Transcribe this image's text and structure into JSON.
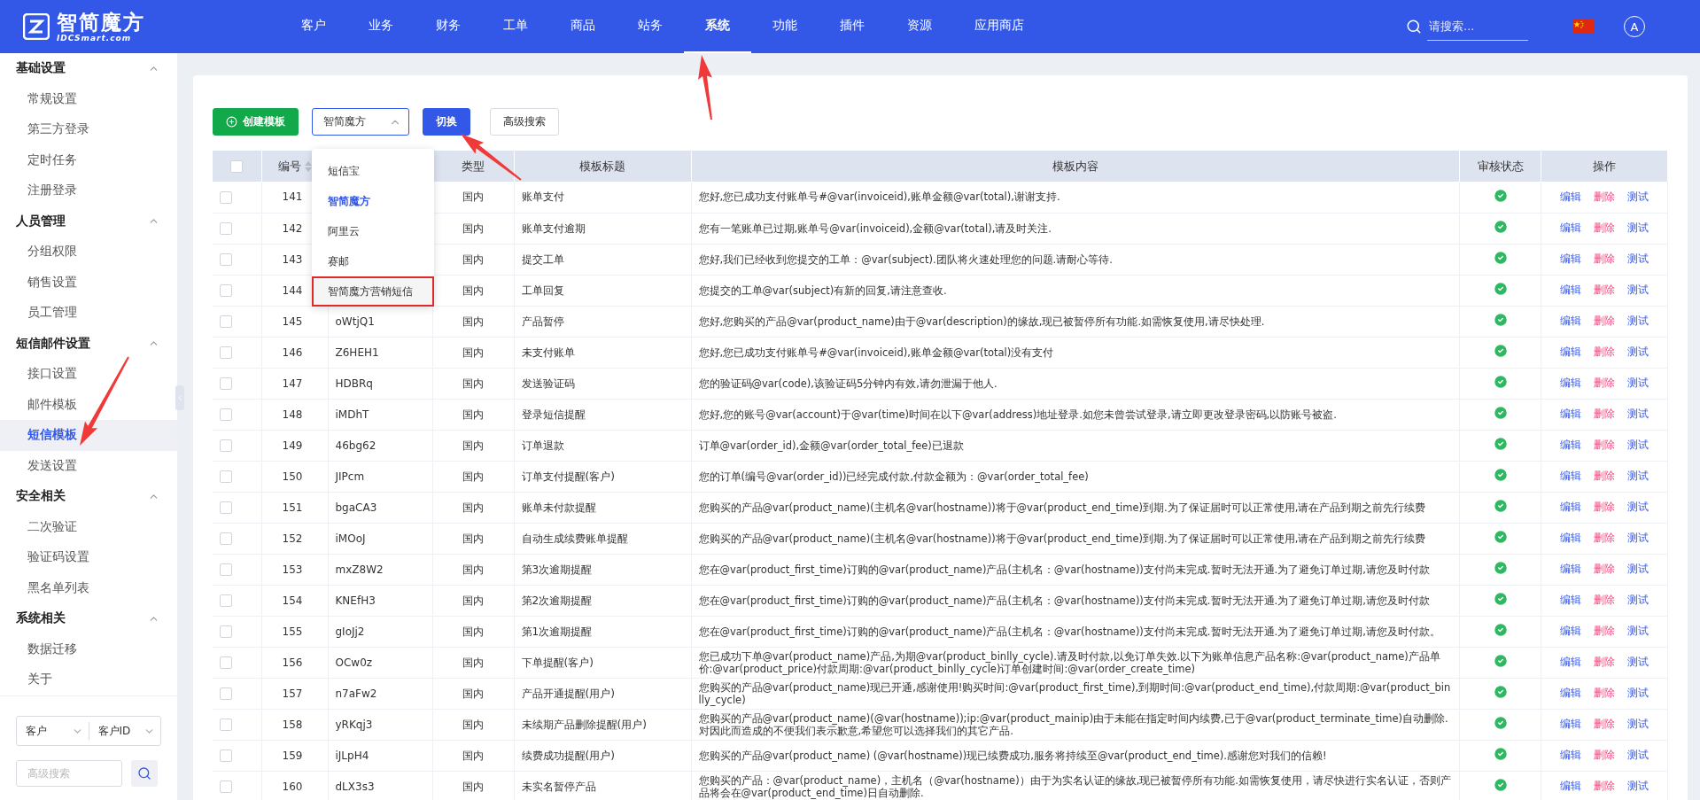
{
  "header": {
    "logo": {
      "name": "智简魔方",
      "domain": "IDCSmart.com"
    },
    "nav": [
      {
        "label": "客户",
        "selected": false
      },
      {
        "label": "业务",
        "selected": false
      },
      {
        "label": "财务",
        "selected": false
      },
      {
        "label": "工单",
        "selected": false
      },
      {
        "label": "商品",
        "selected": false
      },
      {
        "label": "站务",
        "selected": false
      },
      {
        "label": "系统",
        "selected": true
      },
      {
        "label": "功能",
        "selected": false
      },
      {
        "label": "插件",
        "selected": false
      },
      {
        "label": "资源",
        "selected": false
      },
      {
        "label": "应用商店",
        "selected": false
      }
    ],
    "search": {
      "placeholder": "请搜索..."
    },
    "avatar": "A"
  },
  "sidebar": {
    "groups": [
      {
        "title": "基础设置",
        "expanded": true,
        "items": [
          {
            "label": "常规设置",
            "selected": false
          },
          {
            "label": "第三方登录",
            "selected": false
          },
          {
            "label": "定时任务",
            "selected": false
          },
          {
            "label": "注册登录",
            "selected": false
          }
        ]
      },
      {
        "title": "人员管理",
        "expanded": true,
        "items": [
          {
            "label": "分组权限",
            "selected": false
          },
          {
            "label": "销售设置",
            "selected": false
          },
          {
            "label": "员工管理",
            "selected": false
          }
        ]
      },
      {
        "title": "短信邮件设置",
        "expanded": true,
        "items": [
          {
            "label": "接口设置",
            "selected": false
          },
          {
            "label": "邮件模板",
            "selected": false
          },
          {
            "label": "短信模板",
            "selected": true
          },
          {
            "label": "发送设置",
            "selected": false
          }
        ]
      },
      {
        "title": "安全相关",
        "expanded": true,
        "items": [
          {
            "label": "二次验证",
            "selected": false
          },
          {
            "label": "验证码设置",
            "selected": false
          },
          {
            "label": "黑名单列表",
            "selected": false
          }
        ]
      },
      {
        "title": "系统相关",
        "expanded": true,
        "items": [
          {
            "label": "数据迁移",
            "selected": false
          },
          {
            "label": "关于",
            "selected": false
          }
        ]
      }
    ],
    "filters": {
      "field_select": "客户",
      "id_select": "客户ID",
      "search": {
        "placeholder": "高级搜索"
      }
    }
  },
  "toolbar": {
    "create_button": "创建模板",
    "provider_select": {
      "value": "智简魔方",
      "expanded": true,
      "options": [
        {
          "label": "短信宝",
          "selected": false,
          "highlighted": false
        },
        {
          "label": "智简魔方",
          "selected": true,
          "highlighted": false
        },
        {
          "label": "阿里云",
          "selected": false,
          "highlighted": false
        },
        {
          "label": "赛邮",
          "selected": false,
          "highlighted": false
        },
        {
          "label": "智简魔方营销短信",
          "selected": false,
          "highlighted": true
        }
      ]
    },
    "switch_button": "切换",
    "advanced_search_button": "高级搜索"
  },
  "table": {
    "header_checked": false,
    "columns": [
      "编号",
      "类型",
      "模板标题",
      "模板内容",
      "审核状态",
      "操作"
    ],
    "rows": [
      {
        "id": "141",
        "type": "国内",
        "title": "账单支付",
        "content": "您好,您已成功支付账单号#@var(invoiceid),账单金额@var(total),谢谢支持.",
        "approved": true,
        "checked": false,
        "actions": [
          {
            "label": "编辑",
            "kind": "link"
          },
          {
            "label": "删除",
            "kind": "danger"
          },
          {
            "label": "测试",
            "kind": "link"
          }
        ]
      },
      {
        "id": "142",
        "type": "国内",
        "title": "账单支付逾期",
        "content": "您有一笔账单已过期,账单号@var(invoiceid),金额@var(total),请及时关注.",
        "approved": true,
        "checked": false,
        "actions": [
          {
            "label": "编辑",
            "kind": "link"
          },
          {
            "label": "删除",
            "kind": "danger"
          },
          {
            "label": "测试",
            "kind": "link"
          }
        ]
      },
      {
        "id": "143",
        "type": "国内",
        "title": "提交工单",
        "content": "您好,我们已经收到您提交的工单：@var(subject).团队将火速处理您的问题.请耐心等待.",
        "approved": true,
        "checked": false,
        "actions": [
          {
            "label": "编辑",
            "kind": "link"
          },
          {
            "label": "删除",
            "kind": "danger"
          },
          {
            "label": "测试",
            "kind": "link"
          }
        ]
      },
      {
        "id": "144",
        "type": "国内",
        "title": "工单回复",
        "content": "您提交的工单@var(subject)有新的回复,请注意查收.",
        "approved": true,
        "checked": false,
        "actions": [
          {
            "label": "编辑",
            "kind": "link"
          },
          {
            "label": "删除",
            "kind": "danger"
          },
          {
            "label": "测试",
            "kind": "link"
          }
        ]
      },
      {
        "id": "145",
        "code": "oWtjQ1",
        "type": "国内",
        "title": "产品暂停",
        "content": "您好,您购买的产品@var(product_name)由于@var(description)的缘故,现已被暂停所有功能.如需恢复使用,请尽快处理.",
        "approved": true,
        "checked": false,
        "actions": [
          {
            "label": "编辑",
            "kind": "link"
          },
          {
            "label": "删除",
            "kind": "danger"
          },
          {
            "label": "测试",
            "kind": "link"
          }
        ]
      },
      {
        "id": "146",
        "code": "Z6HEH1",
        "type": "国内",
        "title": "未支付账单",
        "content": "您好,您已成功支付账单号#@var(invoiceid),账单金额@var(total)没有支付",
        "approved": true,
        "checked": false,
        "actions": [
          {
            "label": "编辑",
            "kind": "link"
          },
          {
            "label": "删除",
            "kind": "danger"
          },
          {
            "label": "测试",
            "kind": "link"
          }
        ]
      },
      {
        "id": "147",
        "code": "HDBRq",
        "type": "国内",
        "title": "发送验证码",
        "content": "您的验证码@var(code),该验证码5分钟内有效,请勿泄漏于他人.",
        "approved": true,
        "checked": false,
        "actions": [
          {
            "label": "编辑",
            "kind": "link"
          },
          {
            "label": "删除",
            "kind": "danger"
          },
          {
            "label": "测试",
            "kind": "link"
          }
        ]
      },
      {
        "id": "148",
        "code": "iMDhT",
        "type": "国内",
        "title": "登录短信提醒",
        "content": "您好,您的账号@var(account)于@var(time)时间在以下@var(address)地址登录.如您未曾尝试登录,请立即更改登录密码,以防账号被盗.",
        "approved": true,
        "checked": false,
        "actions": [
          {
            "label": "编辑",
            "kind": "link"
          },
          {
            "label": "删除",
            "kind": "danger"
          },
          {
            "label": "测试",
            "kind": "link"
          }
        ]
      },
      {
        "id": "149",
        "code": "46bg62",
        "type": "国内",
        "title": "订单退款",
        "content": "订单@var(order_id),金额@var(order_total_fee)已退款",
        "approved": true,
        "checked": false,
        "actions": [
          {
            "label": "编辑",
            "kind": "link"
          },
          {
            "label": "删除",
            "kind": "danger"
          },
          {
            "label": "测试",
            "kind": "link"
          }
        ]
      },
      {
        "id": "150",
        "code": "JIPcm",
        "type": "国内",
        "title": "订单支付提醒(客户)",
        "content": "您的订单(编号@var(order_id))已经完成付款,付款金额为：@var(order_total_fee)",
        "approved": true,
        "checked": false,
        "actions": [
          {
            "label": "编辑",
            "kind": "link"
          },
          {
            "label": "删除",
            "kind": "danger"
          },
          {
            "label": "测试",
            "kind": "link"
          }
        ]
      },
      {
        "id": "151",
        "code": "bgaCA3",
        "type": "国内",
        "title": "账单未付款提醒",
        "content": "您购买的产品@var(product_name)(主机名@var(hostname))将于@var(product_end_time)到期.为了保证届时可以正常使用,请在产品到期之前先行续费",
        "approved": true,
        "checked": false,
        "actions": [
          {
            "label": "编辑",
            "kind": "link"
          },
          {
            "label": "删除",
            "kind": "danger"
          },
          {
            "label": "测试",
            "kind": "link"
          }
        ]
      },
      {
        "id": "152",
        "code": "iMOoJ",
        "type": "国内",
        "title": "自动生成续费账单提醒",
        "content": "您购买的产品@var(product_name)(主机名@var(hostname))将于@var(product_end_time)到期.为了保证届时可以正常使用,请在产品到期之前先行续费",
        "approved": true,
        "checked": false,
        "actions": [
          {
            "label": "编辑",
            "kind": "link"
          },
          {
            "label": "删除",
            "kind": "danger"
          },
          {
            "label": "测试",
            "kind": "link"
          }
        ]
      },
      {
        "id": "153",
        "code": "mxZ8W2",
        "type": "国内",
        "title": "第3次逾期提醒",
        "content": "您在@var(product_first_time)订购的@var(product_name)产品(主机名：@var(hostname))支付尚未完成.暂时无法开通.为了避免订单过期,请您及时付款",
        "approved": true,
        "checked": false,
        "actions": [
          {
            "label": "编辑",
            "kind": "link"
          },
          {
            "label": "删除",
            "kind": "danger"
          },
          {
            "label": "测试",
            "kind": "link"
          }
        ]
      },
      {
        "id": "154",
        "code": "KNEfH3",
        "type": "国内",
        "title": "第2次逾期提醒",
        "content": "您在@var(product_first_time)订购的@var(product_name)产品(主机名：@var(hostname))支付尚未完成.暂时无法开通.为了避免订单过期,请您及时付款",
        "approved": true,
        "checked": false,
        "actions": [
          {
            "label": "编辑",
            "kind": "link"
          },
          {
            "label": "删除",
            "kind": "danger"
          },
          {
            "label": "测试",
            "kind": "link"
          }
        ]
      },
      {
        "id": "155",
        "code": "gIoJj2",
        "type": "国内",
        "title": "第1次逾期提醒",
        "content": "您在@var(product_first_time)订购的@var(product_name)产品(主机名：@var(hostname))支付尚未完成.暂时无法开通.为了避免订单过期,请您及时付款。",
        "approved": true,
        "checked": false,
        "actions": [
          {
            "label": "编辑",
            "kind": "link"
          },
          {
            "label": "删除",
            "kind": "danger"
          },
          {
            "label": "测试",
            "kind": "link"
          }
        ]
      },
      {
        "id": "156",
        "code": "OCw0z",
        "type": "国内",
        "title": "下单提醒(客户)",
        "content": "您已成功下单@var(product_name)产品,为期@var(product_binlly_cycle).请及时付款,以免订单失效.以下为账单信息产品名称:@var(product_name)产品单价:@var(product_price)付款周期:@var(product_binlly_cycle)订单创建时间:@var(order_create_time)",
        "approved": true,
        "checked": false,
        "actions": [
          {
            "label": "编辑",
            "kind": "link"
          },
          {
            "label": "删除",
            "kind": "danger"
          },
          {
            "label": "测试",
            "kind": "link"
          }
        ]
      },
      {
        "id": "157",
        "code": "n7aFw2",
        "type": "国内",
        "title": "产品开通提醒(用户)",
        "content": "您购买的产品@var(product_name)现已开通,感谢使用!购买时间:@var(product_first_time),到期时间:@var(product_end_time),付款周期:@var(product_binlly_cycle)",
        "approved": true,
        "checked": false,
        "actions": [
          {
            "label": "编辑",
            "kind": "link"
          },
          {
            "label": "删除",
            "kind": "danger"
          },
          {
            "label": "测试",
            "kind": "link"
          }
        ]
      },
      {
        "id": "158",
        "code": "yRKqj3",
        "type": "国内",
        "title": "未续期产品删除提醒(用户)",
        "content": "您购买的产品@var(product_name)(@var(hostname));ip:@var(product_mainip)由于未能在指定时间内续费,已于@var(product_terminate_time)自动删除.对因此而造成的不便我们表示歉意,希望您可以选择我们的其它产品.",
        "approved": true,
        "checked": false,
        "actions": [
          {
            "label": "编辑",
            "kind": "link"
          },
          {
            "label": "删除",
            "kind": "danger"
          },
          {
            "label": "测试",
            "kind": "link"
          }
        ]
      },
      {
        "id": "159",
        "code": "iJLpH4",
        "type": "国内",
        "title": "续费成功提醒(用户)",
        "content": "您购买的产品@var(product_name) (@var(hostname))现已续费成功,服务将持续至@var(product_end_time).感谢您对我们的信赖!",
        "approved": true,
        "checked": false,
        "actions": [
          {
            "label": "编辑",
            "kind": "link"
          },
          {
            "label": "删除",
            "kind": "danger"
          },
          {
            "label": "测试",
            "kind": "link"
          }
        ]
      },
      {
        "id": "160",
        "code": "dLX3s3",
        "type": "国内",
        "title": "未实名暂停产品",
        "content": "您购买的产品：@var(product_name)，主机名（@var(hostname)）由于为实名认证的缘故,现已被暂停所有功能.如需恢复使用，请尽快进行实名认证，否则产品将会在@var(product_end_time)日自动删除.",
        "approved": true,
        "checked": false,
        "actions": [
          {
            "label": "编辑",
            "kind": "link"
          },
          {
            "label": "删除",
            "kind": "danger"
          },
          {
            "label": "测试",
            "kind": "link"
          }
        ]
      }
    ]
  },
  "annotations": [
    {
      "kind": "arrow"
    },
    {
      "kind": "arrow"
    },
    {
      "kind": "arrow"
    }
  ]
}
